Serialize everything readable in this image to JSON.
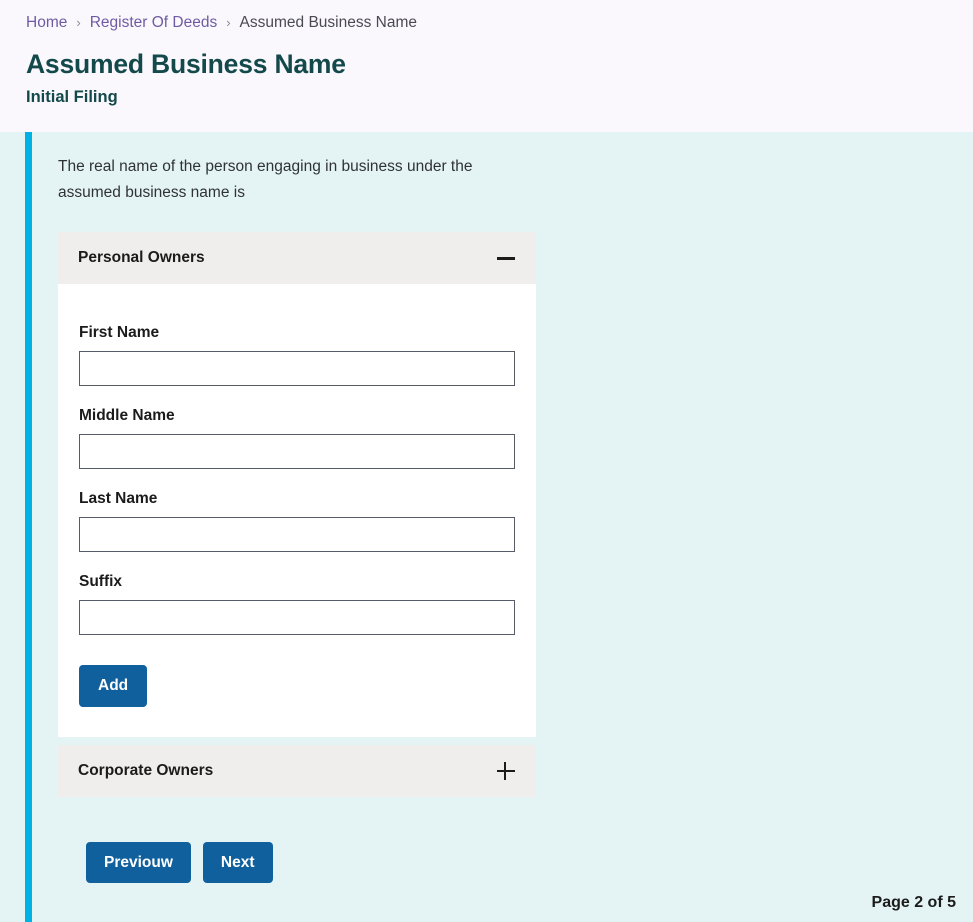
{
  "breadcrumb": {
    "items": [
      {
        "label": "Home",
        "current": false
      },
      {
        "label": "Register Of Deeds",
        "current": false
      },
      {
        "label": "Assumed Business Name",
        "current": true
      }
    ],
    "separator": "›"
  },
  "header": {
    "title": "Assumed Business Name",
    "subtitle": "Initial Filing"
  },
  "main": {
    "intro_text": "The real name of the person engaging in business under the assumed business name is",
    "accordions": [
      {
        "title": "Personal Owners",
        "expanded": true,
        "toggle_icon": "minus-icon",
        "fields": [
          {
            "label": "First Name",
            "value": "",
            "placeholder": ""
          },
          {
            "label": "Middle Name",
            "value": "",
            "placeholder": ""
          },
          {
            "label": "Last Name",
            "value": "",
            "placeholder": ""
          },
          {
            "label": "Suffix",
            "value": "",
            "placeholder": ""
          }
        ],
        "add_label": "Add"
      },
      {
        "title": "Corporate Owners",
        "expanded": false,
        "toggle_icon": "plus-icon"
      }
    ]
  },
  "footer": {
    "previous_label": "Previouw",
    "next_label": "Next",
    "page_indicator": "Page 2 of 5"
  },
  "colors": {
    "accent_bar": "#00b2e3",
    "panel_bg": "#e4f4f4",
    "page_bg": "#faf8fd",
    "title": "#14494b",
    "link": "#6f5ba3",
    "button": "#10609e",
    "accordion_header": "#f0eeec"
  }
}
